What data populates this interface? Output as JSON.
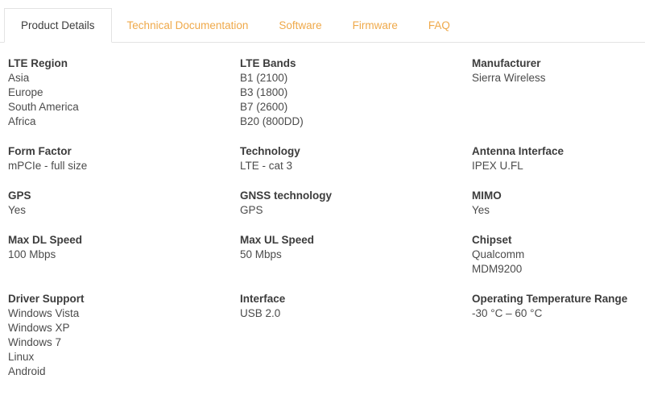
{
  "colors": {
    "accent": "#efa94a",
    "label_text": "#3c3c3c",
    "value_text": "#4b4b4b",
    "border": "#e3e3e3"
  },
  "tabs": [
    {
      "label": "Product Details",
      "active": true
    },
    {
      "label": "Technical Documentation",
      "active": false
    },
    {
      "label": "Software",
      "active": false
    },
    {
      "label": "Firmware",
      "active": false
    },
    {
      "label": "FAQ",
      "active": false
    }
  ],
  "specs": [
    {
      "label": "LTE Region",
      "values": [
        "Asia",
        "Europe",
        "South America",
        "Africa"
      ]
    },
    {
      "label": "LTE Bands",
      "values": [
        "B1 (2100)",
        "B3 (1800)",
        "B7 (2600)",
        "B20 (800DD)"
      ]
    },
    {
      "label": "Manufacturer",
      "values": [
        "Sierra Wireless"
      ]
    },
    {
      "label": "Form Factor",
      "values": [
        "mPCIe - full size"
      ]
    },
    {
      "label": "Technology",
      "values": [
        "LTE - cat 3"
      ]
    },
    {
      "label": "Antenna Interface",
      "values": [
        "IPEX U.FL"
      ]
    },
    {
      "label": "GPS",
      "values": [
        "Yes"
      ]
    },
    {
      "label": "GNSS technology",
      "values": [
        "GPS"
      ]
    },
    {
      "label": "MIMO",
      "values": [
        "Yes"
      ]
    },
    {
      "label": "Max DL Speed",
      "values": [
        "100 Mbps"
      ]
    },
    {
      "label": "Max UL Speed",
      "values": [
        "50 Mbps"
      ]
    },
    {
      "label": "Chipset",
      "values": [
        "Qualcomm",
        "MDM9200"
      ]
    },
    {
      "label": "Driver Support",
      "values": [
        "Windows Vista",
        "Windows XP",
        "Windows 7",
        "Linux",
        "Android"
      ]
    },
    {
      "label": "Interface",
      "values": [
        "USB 2.0"
      ]
    },
    {
      "label": "Operating Temperature Range",
      "values": [
        "-30 °C – 60 °C"
      ]
    }
  ]
}
